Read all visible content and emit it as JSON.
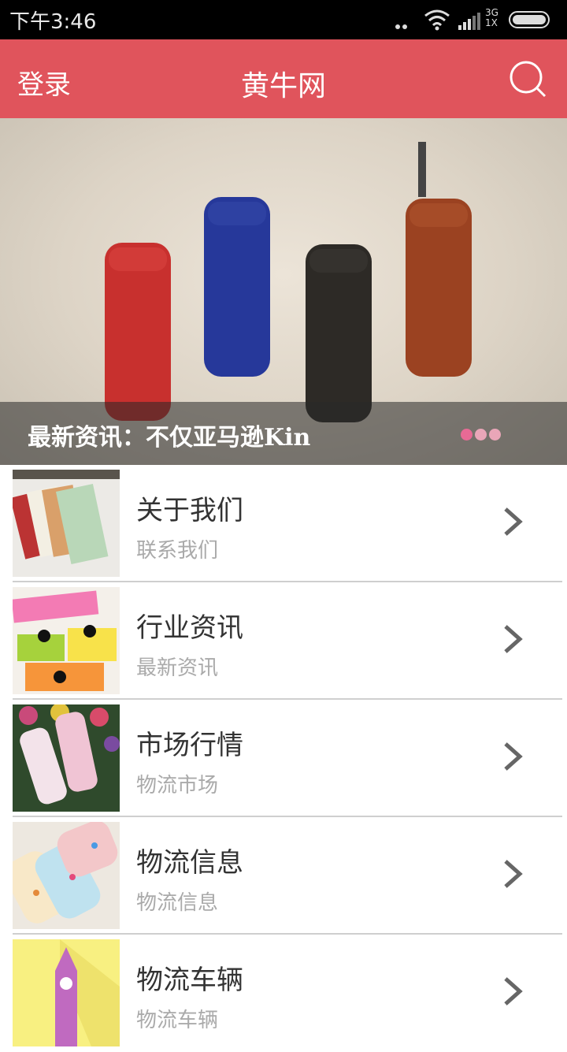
{
  "status": {
    "time": "下午3:46",
    "network_top": "3G",
    "network_bottom": "1X"
  },
  "header": {
    "login_label": "登录",
    "title": "黄牛网"
  },
  "banner": {
    "caption": "最新资讯：不仅亚马逊Kin",
    "page_count": 3,
    "active_page": 1
  },
  "menu": [
    {
      "title": "关于我们",
      "subtitle": "联系我们"
    },
    {
      "title": "行业资讯",
      "subtitle": "最新资讯"
    },
    {
      "title": "市场行情",
      "subtitle": "物流市场"
    },
    {
      "title": "物流信息",
      "subtitle": "物流信息"
    },
    {
      "title": "物流车辆",
      "subtitle": "物流车辆"
    }
  ],
  "colors": {
    "accent": "#e0545c"
  },
  "icons": {
    "search": "search-icon",
    "chevron": "chevron-right-icon"
  }
}
